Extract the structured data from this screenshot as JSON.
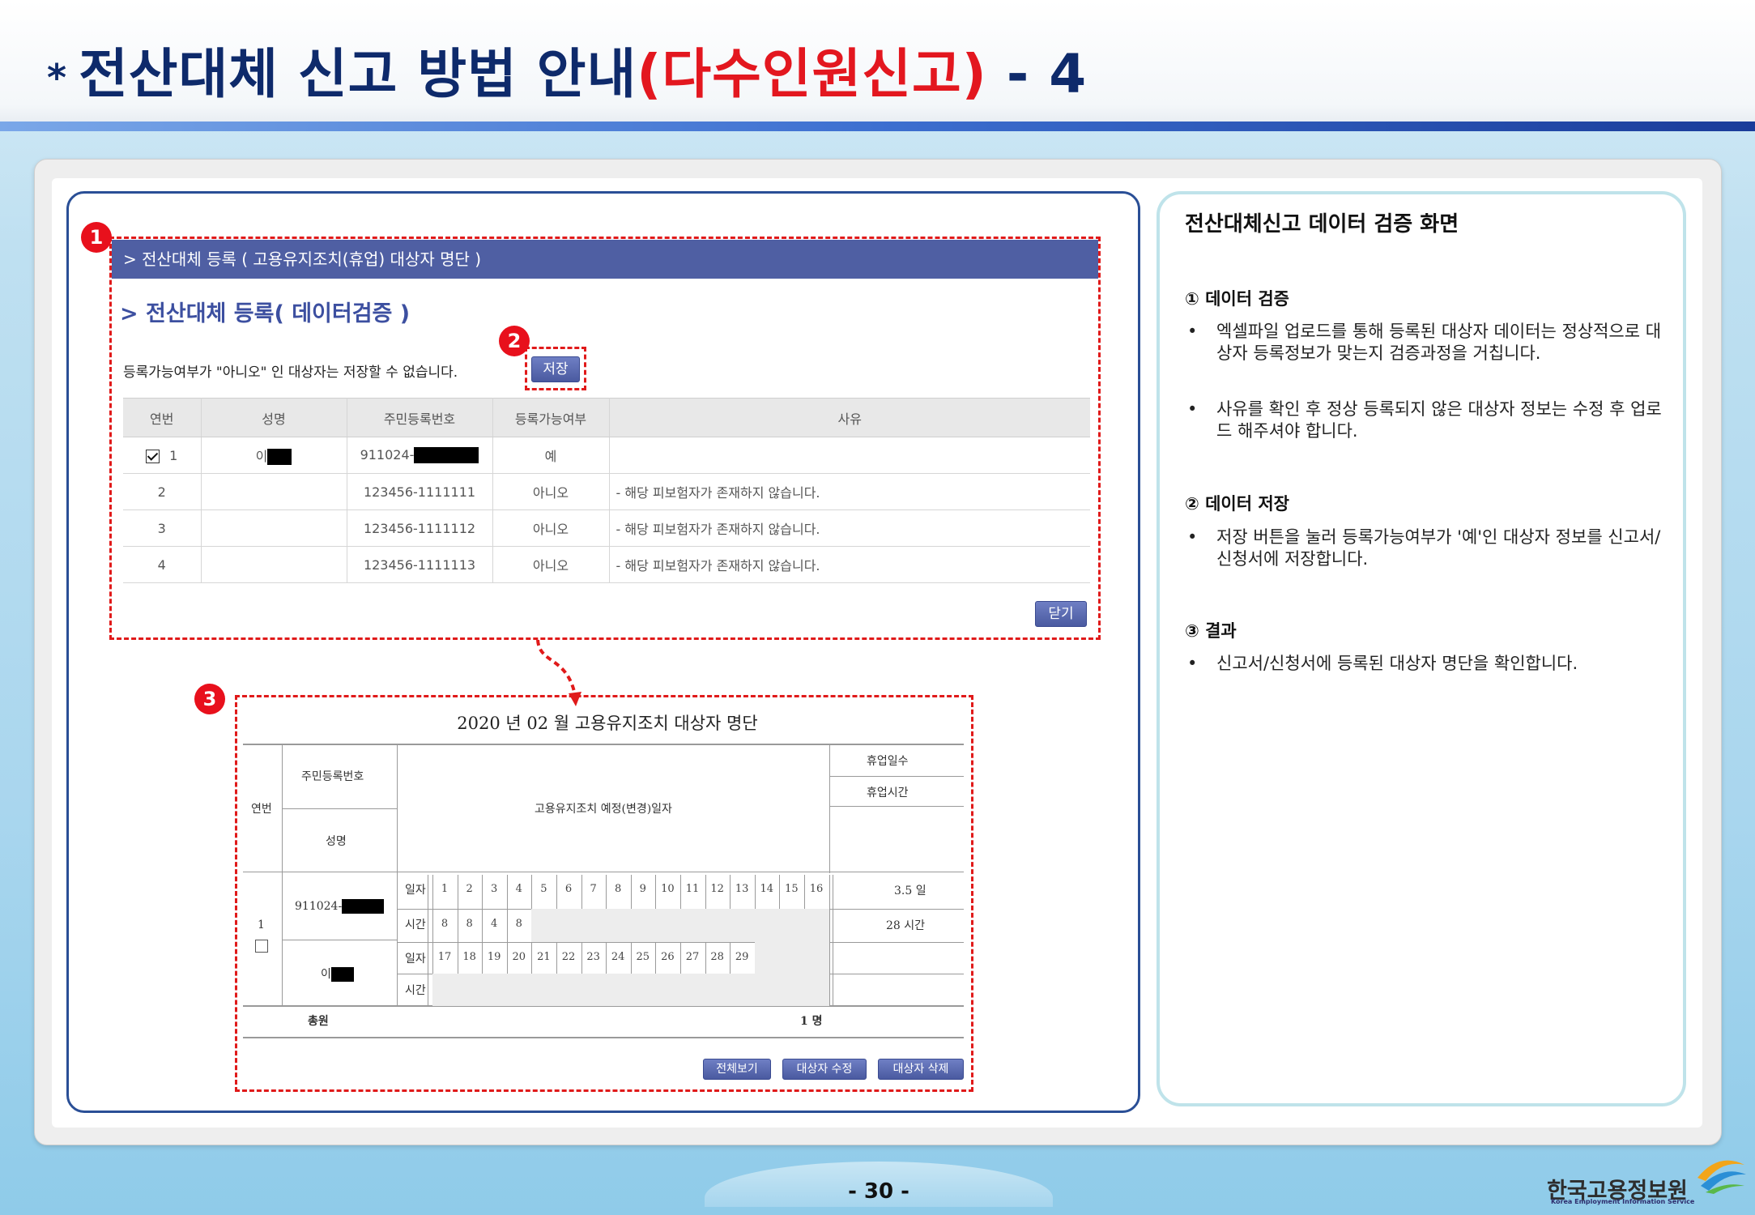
{
  "title": {
    "star": "*",
    "main": "전산대체 신고 방법 안내",
    "highlight": "(다수인원신고)",
    "suffix": "- 4"
  },
  "screen1": {
    "badge": "1",
    "header": "> 전산대체 등록 ( 고용유지조치(휴업) 대상자 명단 )",
    "subtitle": "> 전산대체 등록( 데이터검증 )",
    "note": "등록가능여부가 \"아니오\" 인 대상자는 저장할 수 없습니다.",
    "save_badge": "2",
    "save_label": "저장",
    "columns": [
      "연번",
      "성명",
      "주민등록번호",
      "등록가능여부",
      "사유"
    ],
    "rows": [
      {
        "no": "1",
        "name": "이",
        "rrn": "911024-",
        "ok": "예",
        "reason": ""
      },
      {
        "no": "2",
        "name": "",
        "rrn": "123456-1111111",
        "ok": "아니오",
        "reason": "- 해당 피보험자가 존재하지 않습니다."
      },
      {
        "no": "3",
        "name": "",
        "rrn": "123456-1111112",
        "ok": "아니오",
        "reason": "- 해당 피보험자가 존재하지 않습니다."
      },
      {
        "no": "4",
        "name": "",
        "rrn": "123456-1111113",
        "ok": "아니오",
        "reason": "- 해당 피보험자가 존재하지 않습니다."
      }
    ],
    "close_label": "닫기"
  },
  "screen2": {
    "badge": "3",
    "title": "2020 년      02 월 고용유지조치 대상자 명단",
    "h_no": "연번",
    "h_rrn": "주민등록번호",
    "h_name": "성명",
    "h_dates": "고용유지조치 예정(변경)일자",
    "h_days": "휴업일수",
    "h_hours": "휴업시간",
    "row_no": "1",
    "row_rrn": "911024-",
    "row_name": "이",
    "lbl_day": "일자",
    "lbl_time": "시간",
    "days1": [
      "1",
      "2",
      "3",
      "4",
      "5",
      "6",
      "7",
      "8",
      "9",
      "10",
      "11",
      "12",
      "13",
      "14",
      "15",
      "16"
    ],
    "hours1": [
      "8",
      "8",
      "4",
      "8"
    ],
    "days2": [
      "17",
      "18",
      "19",
      "20",
      "21",
      "22",
      "23",
      "24",
      "25",
      "26",
      "27",
      "28",
      "29"
    ],
    "total_days": "3.5 일",
    "total_hours": "28 시간",
    "total_label": "총원",
    "total_value": "1 명",
    "btn_all": "전체보기",
    "btn_edit": "대상자 수정",
    "btn_delete": "대상자 삭제"
  },
  "right": {
    "title": "전산대체신고 데이터 검증 화면",
    "s1_head": "① 데이터 검증",
    "s1_b1": "엑셀파일 업로드를 통해 등록된 대상자 데이터는 정상적으로 대상자 등록정보가 맞는지 검증과정을 거칩니다.",
    "s1_b2": "사유를 확인 후 정상 등록되지 않은 대상자 정보는 수정 후 업로드 해주셔야 합니다.",
    "s2_head": "② 데이터 저장",
    "s2_b1": "저장 버튼을 눌러 등록가능여부가 '예'인 대상자 정보를 신고서/신청서에 저장합니다.",
    "s3_head": "③ 결과",
    "s3_b1": "신고서/신청서에 등록된 대상자 명단을 확인합니다.",
    "bullet": "•"
  },
  "footer": {
    "page": "- 30 -",
    "logo": "한국고용정보원",
    "logo_sub": "Korea Employment Information Service"
  },
  "colors": {
    "accent_red": "#e3171f",
    "title_navy": "#0e2a6b",
    "header_blue": "#4f5fa3"
  }
}
